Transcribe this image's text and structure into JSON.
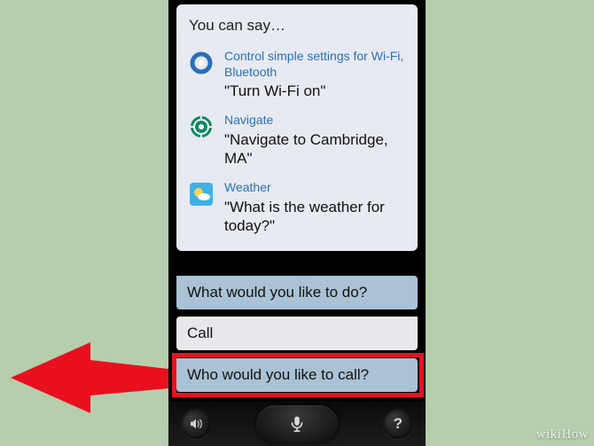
{
  "card": {
    "title": "You can say…",
    "suggestions": [
      {
        "icon": "settings-ring-icon",
        "label": "Control simple settings for Wi-Fi, Bluetooth",
        "example": "\"Turn Wi-Fi on\""
      },
      {
        "icon": "navigate-icon",
        "label": "Navigate",
        "example": "\"Navigate to Cambridge, MA\""
      },
      {
        "icon": "weather-icon",
        "label": "Weather",
        "example": "\"What is the weather for today?\""
      }
    ]
  },
  "bubbles": {
    "assistant1": "What would you like to do?",
    "user1": "Call",
    "assistant2": "Who would you like to call?"
  },
  "bottom": {
    "listen_label": "listen",
    "mic_label": "mic",
    "help_label": "?"
  },
  "watermark": "wikiHow"
}
